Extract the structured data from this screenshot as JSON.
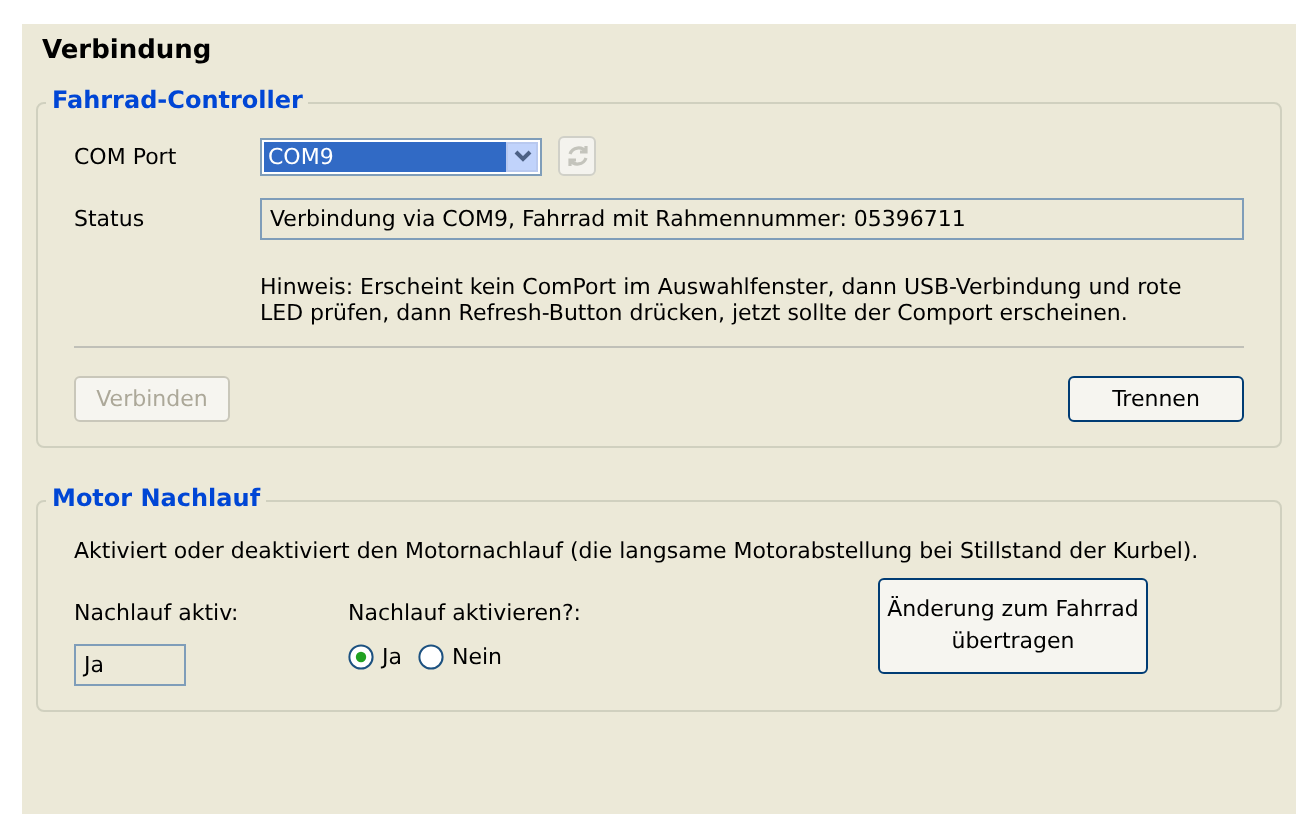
{
  "title": "Verbindung",
  "controller": {
    "legend": "Fahrrad-Controller",
    "com_port": {
      "label": "COM Port",
      "value": "COM9"
    },
    "refresh": {
      "disabled": true
    },
    "status": {
      "label": "Status",
      "value": "Verbindung via COM9, Fahrrad mit Rahmennummer: 05396711"
    },
    "hint": "Hinweis: Erscheint kein ComPort im Auswahlfenster, dann USB-Verbindung und rote LED prüfen, dann Refresh-Button drücken, jetzt sollte der Comport erscheinen.",
    "buttons": [
      {
        "label": "Verbinden",
        "disabled": true
      },
      {
        "label": "Trennen",
        "disabled": false
      }
    ]
  },
  "motor": {
    "legend": "Motor Nachlauf",
    "description": "Aktiviert oder deaktiviert den Motornachlauf (die langsame Motorabstellung bei Stillstand der Kurbel).",
    "active": {
      "label": "Nachlauf aktiv:",
      "value": "Ja"
    },
    "activate": {
      "label": "Nachlauf aktivieren?:",
      "options": [
        {
          "label": "Ja",
          "selected": true
        },
        {
          "label": "Nein",
          "selected": false
        }
      ]
    },
    "apply_button": "Änderung zum Fahrrad übertragen"
  }
}
